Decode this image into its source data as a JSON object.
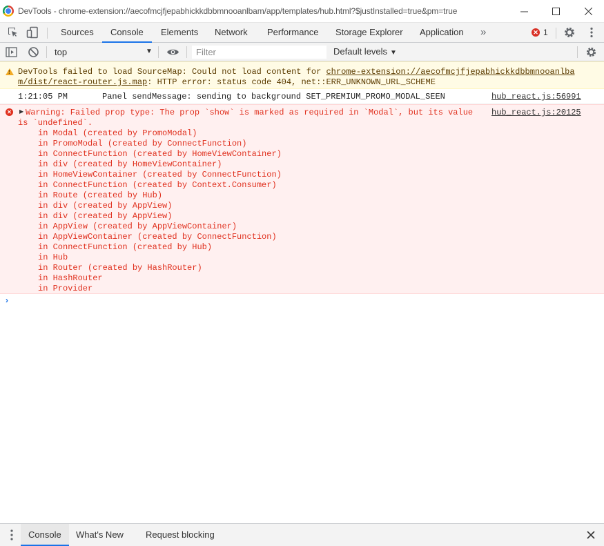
{
  "window": {
    "title": "DevTools - chrome-extension://aecofmcjfjepabhickkdbbmnooanlbam/app/templates/hub.html?$justInstalled=true&pm=true",
    "minimize_icon": "minimize-icon",
    "maximize_icon": "maximize-icon",
    "close_icon": "close-icon"
  },
  "tabs": {
    "items": [
      "Sources",
      "Console",
      "Elements",
      "Network",
      "Performance",
      "Storage Explorer",
      "Application"
    ],
    "active": "Console",
    "more_label": "»",
    "error_count": "1"
  },
  "console_toolbar": {
    "context": "top",
    "filter_placeholder": "Filter",
    "levels_label": "Default levels"
  },
  "messages": {
    "warning": {
      "text_prefix": "DevTools failed to load SourceMap: Could not load content for ",
      "link_part1": "chrome-extension://aecofmcjfjepabhickkdbbmnooanlba",
      "link_part2": "m/dist/react-router.js.map",
      "text_suffix": ": HTTP error: status code 404, net::ERR_UNKNOWN_URL_SCHEME"
    },
    "log": {
      "timestamp": "1:21:05 PM",
      "text": "Panel sendMessage: sending to background SET_PREMIUM_PROMO_MODAL_SEEN",
      "source": "hub_react.js:56991"
    },
    "error": {
      "line1": "Warning: Failed prop type: The prop `show` is marked as required in `Modal`, but its value",
      "line2": "is `undefined`.",
      "source": "hub_react.js:20125",
      "stack": [
        "in Modal (created by PromoModal)",
        "in PromoModal (created by ConnectFunction)",
        "in ConnectFunction (created by HomeViewContainer)",
        "in div (created by HomeViewContainer)",
        "in HomeViewContainer (created by ConnectFunction)",
        "in ConnectFunction (created by Context.Consumer)",
        "in Route (created by Hub)",
        "in div (created by AppView)",
        "in div (created by AppView)",
        "in AppView (created by AppViewContainer)",
        "in AppViewContainer (created by ConnectFunction)",
        "in ConnectFunction (created by Hub)",
        "in Hub",
        "in Router (created by HashRouter)",
        "in HashRouter",
        "in Provider"
      ]
    }
  },
  "drawer": {
    "tabs": [
      "Console",
      "What's New",
      "Request blocking"
    ],
    "active": "Console"
  },
  "colors": {
    "accent": "#1a73e8",
    "error_text": "#e0301e",
    "error_bg": "#fff0f0",
    "warning_bg": "#fffbe5",
    "warning_text": "#5c3c00"
  }
}
